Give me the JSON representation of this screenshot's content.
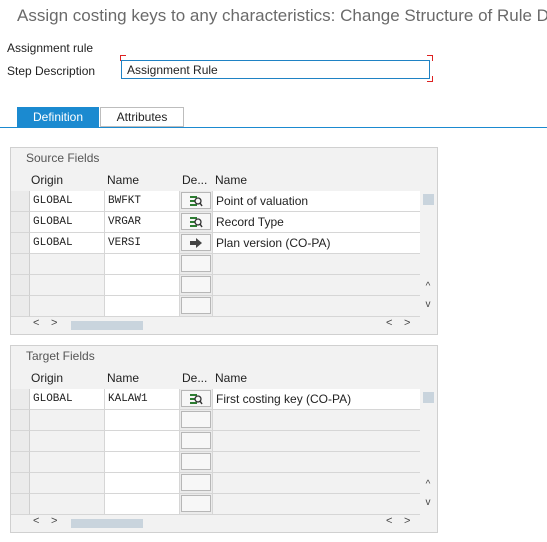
{
  "window": {
    "title": "Assign costing keys to any characteristics: Change Structure of Rule D"
  },
  "header": {
    "assignment_rule_label": "Assignment rule",
    "step_description_label": "Step Description",
    "step_description_value": "Assignment Rule"
  },
  "tabs": [
    {
      "label": "Definition",
      "active": true
    },
    {
      "label": "Attributes",
      "active": false
    }
  ],
  "source": {
    "title": "Source Fields",
    "columns": {
      "origin": "Origin",
      "name": "Name",
      "de": "De...",
      "desc": "Name"
    },
    "rows": [
      {
        "origin": "GLOBAL",
        "name": "BWFKT",
        "icon": "search-list-icon",
        "desc": "Point of valuation"
      },
      {
        "origin": "GLOBAL",
        "name": "VRGAR",
        "icon": "search-list-icon",
        "desc": "Record Type"
      },
      {
        "origin": "GLOBAL",
        "name": "VERSI",
        "icon": "arrow-right-icon",
        "desc": "Plan version (CO-PA)"
      }
    ]
  },
  "target": {
    "title": "Target Fields",
    "columns": {
      "origin": "Origin",
      "name": "Name",
      "de": "De...",
      "desc": "Name"
    },
    "rows": [
      {
        "origin": "GLOBAL",
        "name": "KALAW1",
        "icon": "search-list-icon",
        "desc": "First costing key (CO-PA)"
      }
    ]
  },
  "colors": {
    "accent": "#1b8ad0",
    "panel_bg": "#f2f2f2",
    "title_text": "#6a6a6a"
  }
}
